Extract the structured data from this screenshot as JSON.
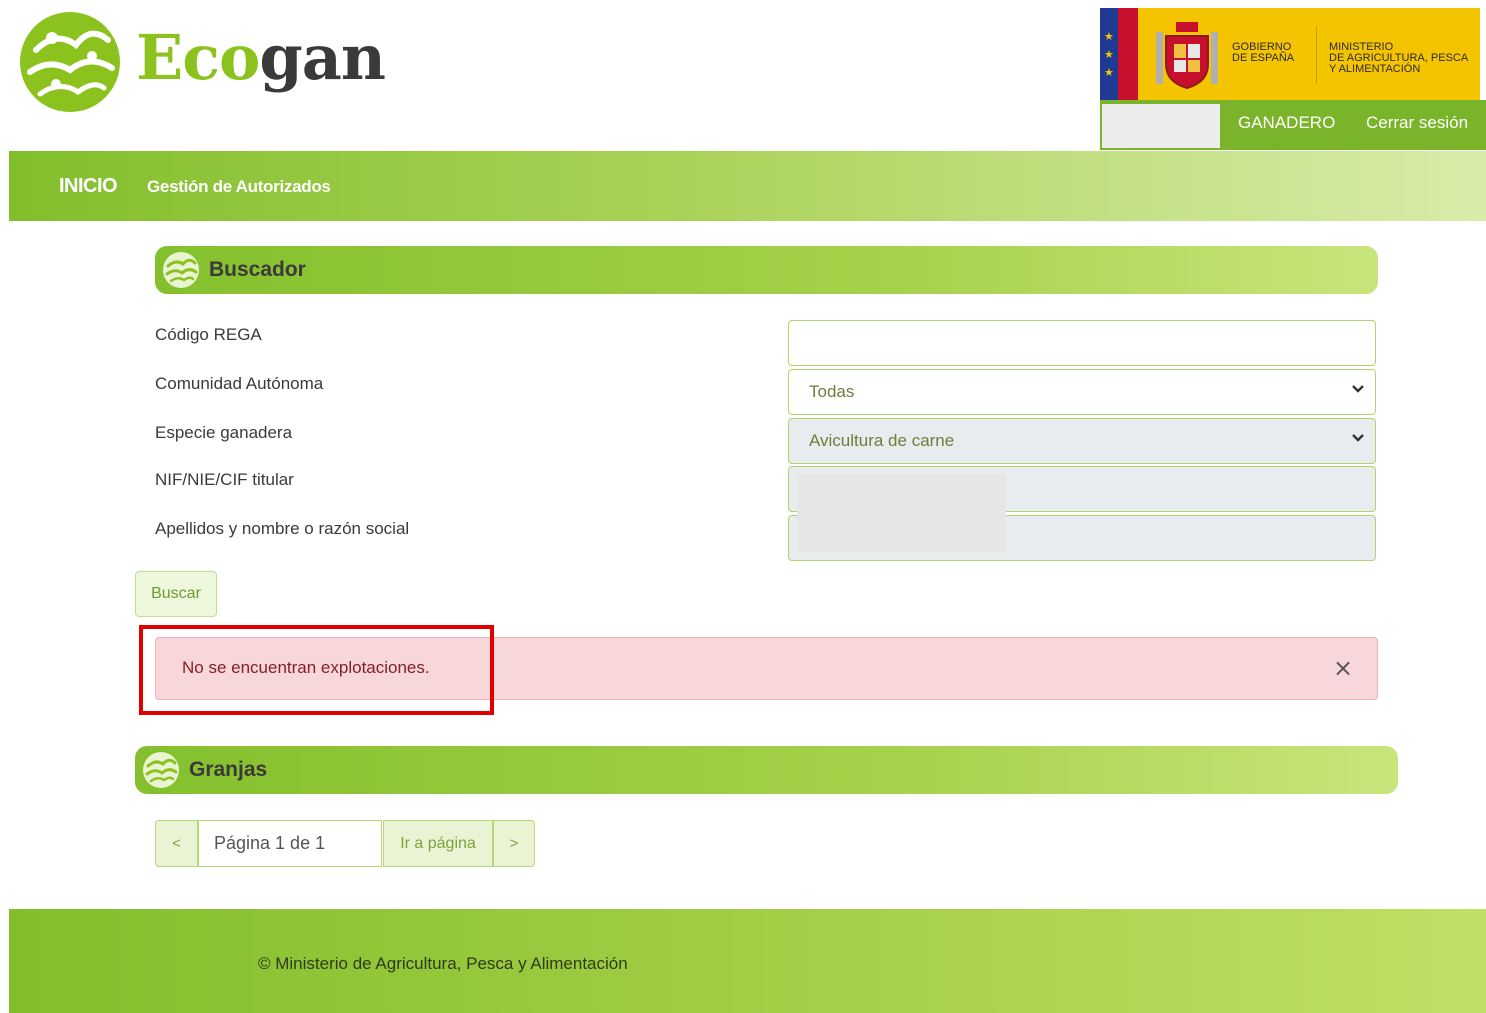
{
  "header": {
    "brand_part1": "Eco",
    "brand_part2": "gan",
    "gov_line1": "GOBIERNO",
    "gov_line2": "DE ESPAÑA",
    "ministry_line1": "MINISTERIO",
    "ministry_line2": "DE AGRICULTURA, PESCA",
    "ministry_line3": "Y ALIMENTACIÓN",
    "role": "GANADERO",
    "logout": "Cerrar sesión"
  },
  "nav": {
    "home": "INICIO",
    "section": "Gestión de Autorizados"
  },
  "search": {
    "title": "Buscador",
    "fields": [
      {
        "label": "Código REGA",
        "value": ""
      },
      {
        "label": "Comunidad Autónoma",
        "value": "Todas"
      },
      {
        "label": "Especie ganadera",
        "value": "Avicultura de carne"
      },
      {
        "label": "NIF/NIE/CIF titular",
        "value": ""
      },
      {
        "label": "Apellidos y nombre o razón social",
        "value": ""
      }
    ],
    "button": "Buscar"
  },
  "alert": {
    "message": "No se encuentran explotaciones.",
    "close": "×"
  },
  "farms": {
    "title": "Granjas",
    "pagination": {
      "prev": "<",
      "page_text": "Página 1 de 1",
      "go": "Ir a página",
      "next": ">"
    }
  },
  "footer": {
    "text": "© Ministerio de Agricultura, Pesca y Alimentación"
  },
  "colors": {
    "brand_green": "#8cc21e",
    "alert_bg": "#f8d7da",
    "highlight": "#e00000",
    "gov_yellow": "#f5c400"
  },
  "icons": [
    "ecogan-logo-icon",
    "coat-of-arms-icon",
    "chevron-down-icon",
    "close-icon"
  ]
}
